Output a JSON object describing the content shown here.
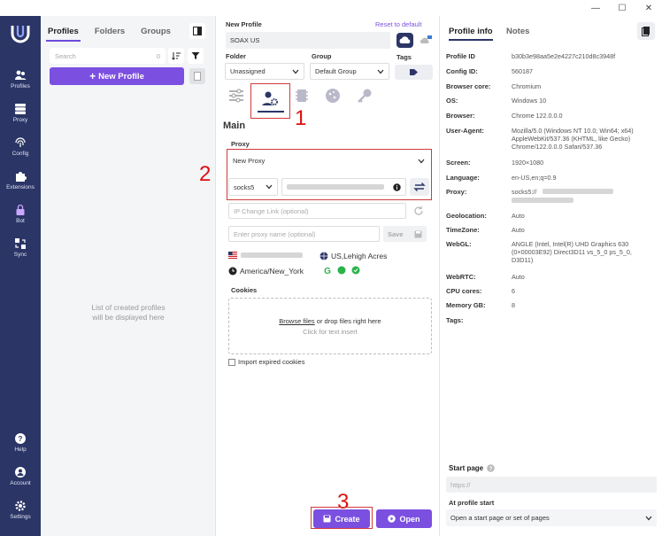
{
  "window": {
    "minimize": "—",
    "maximize": "☐",
    "close": "✕"
  },
  "nav": {
    "items": [
      {
        "label": "Profiles",
        "icon": "people-icon"
      },
      {
        "label": "Proxy",
        "icon": "server-icon"
      },
      {
        "label": "Config",
        "icon": "fingerprint-icon"
      },
      {
        "label": "Extensions",
        "icon": "puzzle-icon"
      },
      {
        "label": "Bot",
        "icon": "lock-icon"
      },
      {
        "label": "Sync",
        "icon": "sync-icon"
      },
      {
        "label": "Help",
        "icon": "help-icon"
      },
      {
        "label": "Account",
        "icon": "account-icon"
      },
      {
        "label": "Settings",
        "icon": "gear-icon"
      }
    ]
  },
  "left": {
    "tabs": [
      "Profiles",
      "Folders",
      "Groups"
    ],
    "search_placeholder": "Search",
    "search_count": "0",
    "new_profile": "New Profile",
    "new_profile_plus": "+",
    "empty_line1": "List of created profiles",
    "empty_line2": "will be displayed here"
  },
  "form": {
    "name_label": "New Profile",
    "reset": "Reset to default",
    "name_value": "SOAX US",
    "folder_label": "Folder",
    "folder_value": "Unassigned",
    "group_label": "Group",
    "group_value": "Default Group",
    "tags_label": "Tags",
    "section": "Main",
    "proxy_label": "Proxy",
    "proxy_select": "New Proxy",
    "proxy_type": "socks5",
    "ip_change_placeholder": "IP Change Link (optional)",
    "proxy_name_placeholder": "Enter proxy name (optional)",
    "save": "Save",
    "location": "US,Lehigh Acres",
    "timezone": "America/New_York",
    "cookies_label": "Cookies",
    "browse": "Browse files",
    "drop_text": " or drop files right here",
    "click_text": "Click for text insert",
    "import_expired": "Import expired cookies",
    "create": "Create",
    "open": "Open"
  },
  "annotations": {
    "one": "1",
    "two": "2",
    "three": "3"
  },
  "right": {
    "tabs": [
      "Profile info",
      "Notes"
    ],
    "rows": [
      {
        "k": "Profile ID",
        "v": "b30b3e98aa5e2e4227c210d8c3948f"
      },
      {
        "k": "Config ID:",
        "v": "560187"
      },
      {
        "k": "Browser core:",
        "v": "Chromium"
      },
      {
        "k": "OS:",
        "v": "Windows 10"
      },
      {
        "k": "Browser:",
        "v": "Chrome 122.0.0.0"
      },
      {
        "k": "User-Agent:",
        "v": "Mozilla/5.0 (Windows NT 10.0; Win64; x64) AppleWebKit/537.36 (KHTML, like Gecko) Chrome/122.0.0.0 Safari/537.36"
      },
      {
        "k": "Screen:",
        "v": "1920×1080"
      },
      {
        "k": "Language:",
        "v": "en-US,en;q=0.9"
      },
      {
        "k": "Proxy:",
        "v": "socks5://"
      },
      {
        "k": "Geolocation:",
        "v": "Auto"
      },
      {
        "k": "TimeZone:",
        "v": "Auto"
      },
      {
        "k": "WebGL:",
        "v": "ANGLE (Intel, Intel(R) UHD Graphics 630 (0×00003E92) Direct3D11 vs_5_0 ps_5_0, D3D11)"
      },
      {
        "k": "WebRTC:",
        "v": "Auto"
      },
      {
        "k": "CPU cores:",
        "v": "6"
      },
      {
        "k": "Memory GB:",
        "v": "8"
      },
      {
        "k": "Tags:",
        "v": ""
      }
    ],
    "start_page_label": "Start page",
    "start_page_placeholder": "https://",
    "at_start_label": "At profile start",
    "at_start_value": "Open a start page or set of pages"
  },
  "colors": {
    "accent": "#7b4fe0",
    "nav": "#2b3566",
    "annotation": "#d11111"
  }
}
